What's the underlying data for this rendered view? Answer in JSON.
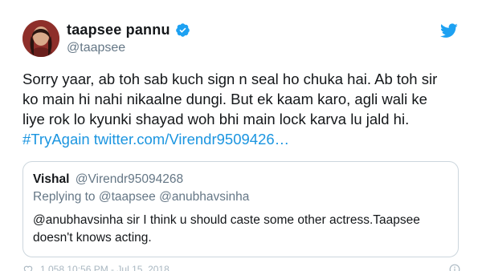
{
  "author": {
    "name": "taapsee pannu",
    "handle": "@taapsee"
  },
  "icons": {
    "verified": "verified-badge-icon",
    "brand": "twitter-bird-icon",
    "like": "heart-icon",
    "info": "info-icon"
  },
  "colors": {
    "link": "#1b95e0",
    "verified": "#1da1f2",
    "muted": "#657786",
    "border": "#ccd6dd"
  },
  "tweet": {
    "text_line1": "Sorry yaar, ab toh sab kuch sign n seal ho chuka hai. Ab toh sir",
    "text_line2": "ko main hi nahi nikaalne dungi. But ek kaam karo, agli wali ke",
    "text_line3": "liye rok lo kyunki shayad woh bhi main lock karva lu jald hi.",
    "hashtag": "#TryAgain",
    "link": "twitter.com/Virendr9509426…"
  },
  "quoted": {
    "name": "Vishal",
    "handle": "@Virendr95094268",
    "replying_label": "Replying to",
    "replying_to_1": "@taapsee",
    "replying_to_2": "@anubhavsinha",
    "body": "@anubhavsinha sir I think u should caste some other actress.Taapsee doesn't knows acting."
  },
  "footer": {
    "meta": "1,058   10:56 PM - Jul 15, 2018"
  }
}
